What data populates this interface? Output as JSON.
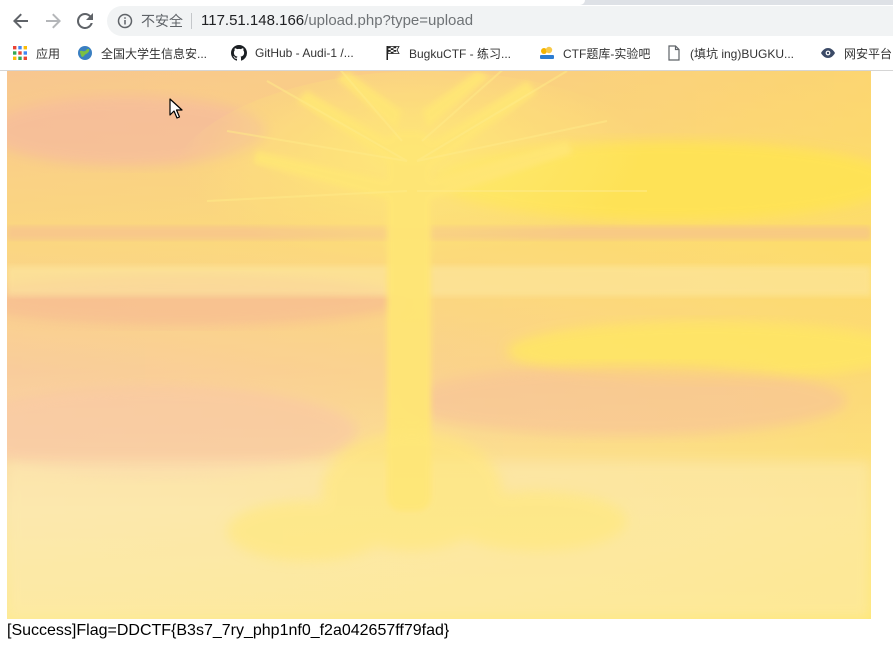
{
  "browser": {
    "nav": {
      "back_icon": "arrow-left-icon",
      "forward_icon": "arrow-right-icon",
      "reload_icon": "reload-icon"
    },
    "address_bar": {
      "info_icon": "info-circle-icon",
      "security_label": "不安全",
      "url_host": "117.51.148.166",
      "url_path": "/upload.php?type=upload"
    },
    "bookmarks": [
      {
        "label": "应用",
        "icon": "apps-grid-icon"
      },
      {
        "label": "全国大学生信息安...",
        "icon": "globe-icon"
      },
      {
        "label": "GitHub - Audi-1 /...",
        "icon": "github-icon"
      },
      {
        "label": "BugkuCTF - 练习...",
        "icon": "checkered-flag-icon"
      },
      {
        "label": "CTF题库-实验吧",
        "icon": "site-logo-icon"
      },
      {
        "label": "(填坑 ing)BUGKU...",
        "icon": "document-icon"
      },
      {
        "label": "网安平台",
        "icon": "eye-logo-icon"
      }
    ]
  },
  "page": {
    "image_description_alt": "uploaded image",
    "result_text": "[Success]Flag=DDCTF{B3s7_7ry_php1nf0_f2a042657ff79fad}"
  },
  "colors": {
    "omnibox_bg": "#f1f3f4",
    "image_yellow": "#ffe66a",
    "image_peach": "#f9c28f",
    "image_pink": "#f6b3a0"
  }
}
